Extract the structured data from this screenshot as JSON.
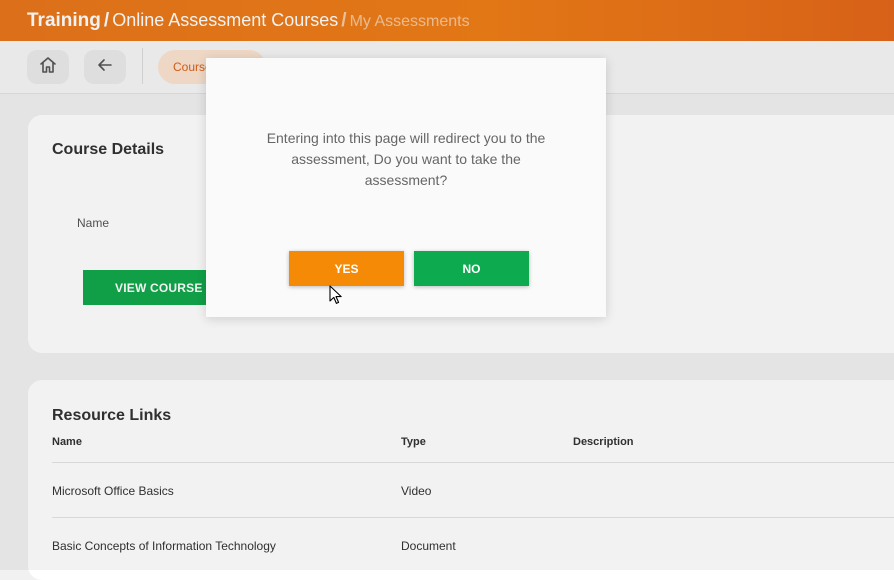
{
  "header": {
    "breadcrumb": [
      "Training",
      "Online Assessment Courses",
      "My Assessments"
    ],
    "separator": "/"
  },
  "toolbar": {
    "home_icon": "home-icon",
    "back_icon": "arrow-left-icon",
    "active_pill": "Course Details"
  },
  "course_details": {
    "title": "Course Details",
    "name_label": "Name",
    "view_course_label": "VIEW COURSE"
  },
  "resource_links": {
    "title": "Resource Links",
    "columns": [
      "Name",
      "Type",
      "Description"
    ],
    "rows": [
      {
        "name": "Microsoft Office Basics",
        "type": "Video",
        "description": ""
      },
      {
        "name": "Basic Concepts of Information Technology",
        "type": "Document",
        "description": ""
      }
    ]
  },
  "dialog": {
    "message": "Entering into this page will redirect you to the assessment, Do you want to take the assessment?",
    "yes_label": "YES",
    "no_label": "NO"
  },
  "colors": {
    "header": "#ef7e18",
    "yes": "#f58a07",
    "no": "#0daa4f",
    "view_course": "#11a84b"
  }
}
